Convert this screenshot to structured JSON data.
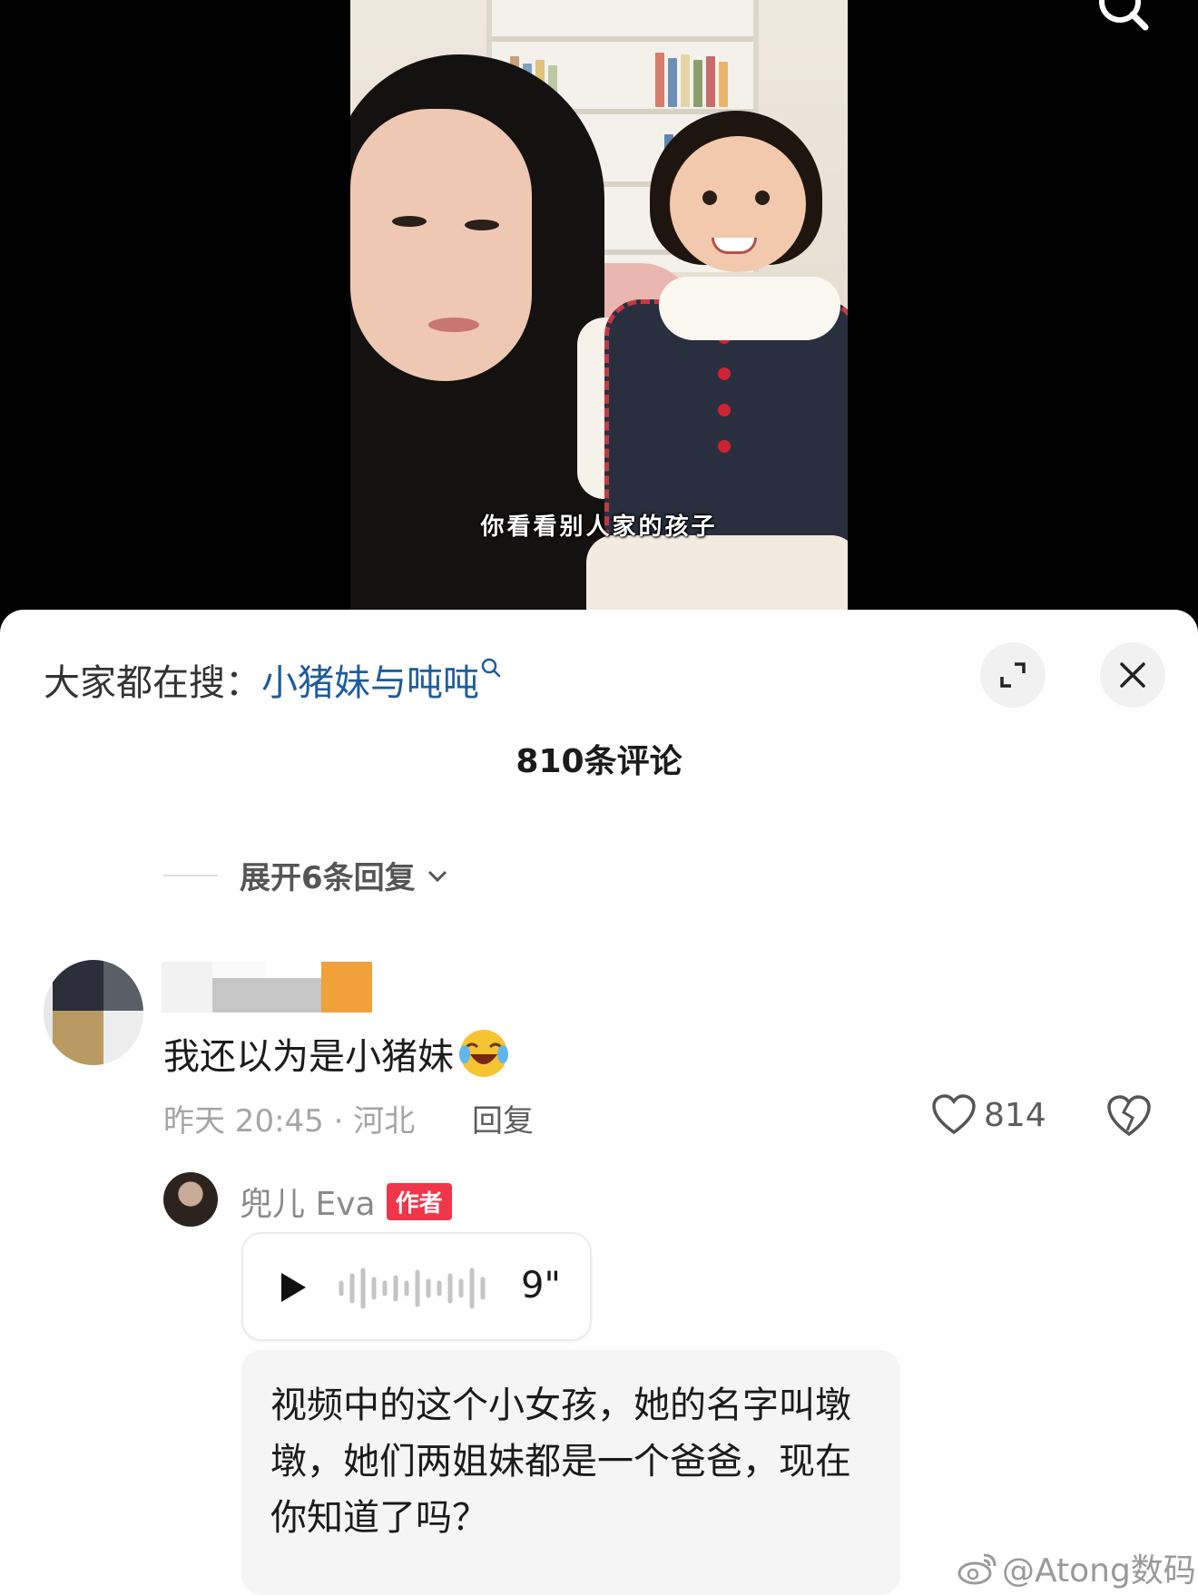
{
  "video": {
    "subtitle": "你看看别人家的孩子"
  },
  "sheet": {
    "hot_search_prefix": "大家都在搜：",
    "hot_search_keyword": "小猪妹与吨吨",
    "comment_count_label": "810条评论",
    "expand_replies_label": "展开6条回复"
  },
  "comment": {
    "text": "我还以为是小猪妹",
    "emoji": "laughing-crying-emoji",
    "time_location": "昨天 20:45 · 河北",
    "reply_label": "回复",
    "like_count": "814"
  },
  "author_reply": {
    "name": "兜儿 Eva",
    "badge": "作者",
    "voice_duration": "9\"",
    "transcript": "视频中的这个小女孩，她的名字叫墩墩，她们两姐妹都是一个爸爸，现在你知道了吗？"
  },
  "watermark": {
    "text": "@Atong数码"
  },
  "colors": {
    "keyword": "#1e5c9c",
    "author_badge": "#f0364b",
    "meta_text": "#a5a5a5"
  }
}
